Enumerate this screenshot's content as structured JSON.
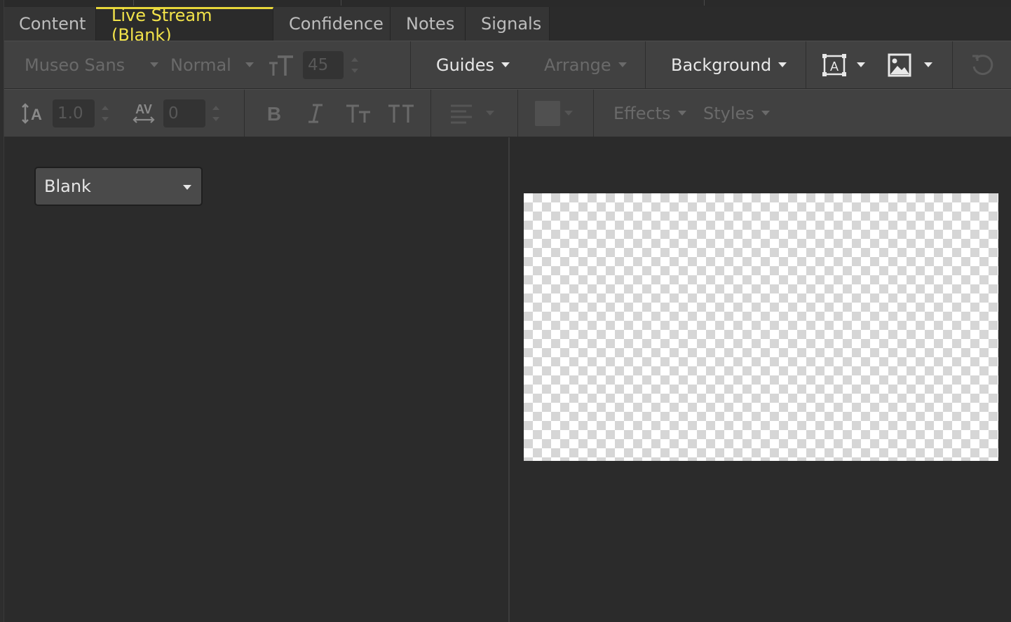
{
  "tabs": [
    {
      "label": "Content",
      "active": false
    },
    {
      "label": "Live Stream (Blank)",
      "active": true
    },
    {
      "label": "Confidence",
      "active": false
    },
    {
      "label": "Notes",
      "active": false
    },
    {
      "label": "Signals",
      "active": false
    }
  ],
  "toolbar1": {
    "font_family": "Museo Sans",
    "font_style": "Normal",
    "font_size": "45",
    "guides_label": "Guides",
    "arrange_label": "Arrange",
    "background_label": "Background",
    "icons": [
      "font-size-icon",
      "text-box-icon",
      "image-icon",
      "refresh-icon"
    ]
  },
  "toolbar2": {
    "line_height": "1.0",
    "letter_spacing": "0",
    "effects_label": "Effects",
    "styles_label": "Styles",
    "icons": [
      "line-height-icon",
      "letter-spacing-icon",
      "bold-icon",
      "italic-icon",
      "small-caps-icon",
      "all-caps-icon",
      "align-icon",
      "color-swatch-icon"
    ]
  },
  "left_panel": {
    "dropdown_value": "Blank"
  },
  "colors": {
    "active_tab_text": "#f2e34a",
    "active_tab_border": "#e8d73a",
    "background": "#2b2b2b",
    "toolbar": "#414141"
  }
}
